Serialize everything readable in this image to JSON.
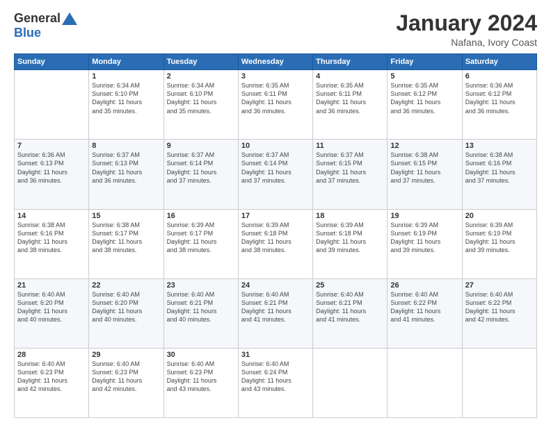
{
  "logo": {
    "general": "General",
    "blue": "Blue"
  },
  "header": {
    "month_year": "January 2024",
    "location": "Nafana, Ivory Coast"
  },
  "days_of_week": [
    "Sunday",
    "Monday",
    "Tuesday",
    "Wednesday",
    "Thursday",
    "Friday",
    "Saturday"
  ],
  "weeks": [
    [
      {
        "day": "",
        "info": ""
      },
      {
        "day": "1",
        "info": "Sunrise: 6:34 AM\nSunset: 6:10 PM\nDaylight: 11 hours\nand 35 minutes."
      },
      {
        "day": "2",
        "info": "Sunrise: 6:34 AM\nSunset: 6:10 PM\nDaylight: 11 hours\nand 35 minutes."
      },
      {
        "day": "3",
        "info": "Sunrise: 6:35 AM\nSunset: 6:11 PM\nDaylight: 11 hours\nand 36 minutes."
      },
      {
        "day": "4",
        "info": "Sunrise: 6:35 AM\nSunset: 6:11 PM\nDaylight: 11 hours\nand 36 minutes."
      },
      {
        "day": "5",
        "info": "Sunrise: 6:35 AM\nSunset: 6:12 PM\nDaylight: 11 hours\nand 36 minutes."
      },
      {
        "day": "6",
        "info": "Sunrise: 6:36 AM\nSunset: 6:12 PM\nDaylight: 11 hours\nand 36 minutes."
      }
    ],
    [
      {
        "day": "7",
        "info": "Sunrise: 6:36 AM\nSunset: 6:13 PM\nDaylight: 11 hours\nand 36 minutes."
      },
      {
        "day": "8",
        "info": "Sunrise: 6:37 AM\nSunset: 6:13 PM\nDaylight: 11 hours\nand 36 minutes."
      },
      {
        "day": "9",
        "info": "Sunrise: 6:37 AM\nSunset: 6:14 PM\nDaylight: 11 hours\nand 37 minutes."
      },
      {
        "day": "10",
        "info": "Sunrise: 6:37 AM\nSunset: 6:14 PM\nDaylight: 11 hours\nand 37 minutes."
      },
      {
        "day": "11",
        "info": "Sunrise: 6:37 AM\nSunset: 6:15 PM\nDaylight: 11 hours\nand 37 minutes."
      },
      {
        "day": "12",
        "info": "Sunrise: 6:38 AM\nSunset: 6:15 PM\nDaylight: 11 hours\nand 37 minutes."
      },
      {
        "day": "13",
        "info": "Sunrise: 6:38 AM\nSunset: 6:16 PM\nDaylight: 11 hours\nand 37 minutes."
      }
    ],
    [
      {
        "day": "14",
        "info": "Sunrise: 6:38 AM\nSunset: 6:16 PM\nDaylight: 11 hours\nand 38 minutes."
      },
      {
        "day": "15",
        "info": "Sunrise: 6:38 AM\nSunset: 6:17 PM\nDaylight: 11 hours\nand 38 minutes."
      },
      {
        "day": "16",
        "info": "Sunrise: 6:39 AM\nSunset: 6:17 PM\nDaylight: 11 hours\nand 38 minutes."
      },
      {
        "day": "17",
        "info": "Sunrise: 6:39 AM\nSunset: 6:18 PM\nDaylight: 11 hours\nand 38 minutes."
      },
      {
        "day": "18",
        "info": "Sunrise: 6:39 AM\nSunset: 6:18 PM\nDaylight: 11 hours\nand 39 minutes."
      },
      {
        "day": "19",
        "info": "Sunrise: 6:39 AM\nSunset: 6:19 PM\nDaylight: 11 hours\nand 39 minutes."
      },
      {
        "day": "20",
        "info": "Sunrise: 6:39 AM\nSunset: 6:19 PM\nDaylight: 11 hours\nand 39 minutes."
      }
    ],
    [
      {
        "day": "21",
        "info": "Sunrise: 6:40 AM\nSunset: 6:20 PM\nDaylight: 11 hours\nand 40 minutes."
      },
      {
        "day": "22",
        "info": "Sunrise: 6:40 AM\nSunset: 6:20 PM\nDaylight: 11 hours\nand 40 minutes."
      },
      {
        "day": "23",
        "info": "Sunrise: 6:40 AM\nSunset: 6:21 PM\nDaylight: 11 hours\nand 40 minutes."
      },
      {
        "day": "24",
        "info": "Sunrise: 6:40 AM\nSunset: 6:21 PM\nDaylight: 11 hours\nand 41 minutes."
      },
      {
        "day": "25",
        "info": "Sunrise: 6:40 AM\nSunset: 6:21 PM\nDaylight: 11 hours\nand 41 minutes."
      },
      {
        "day": "26",
        "info": "Sunrise: 6:40 AM\nSunset: 6:22 PM\nDaylight: 11 hours\nand 41 minutes."
      },
      {
        "day": "27",
        "info": "Sunrise: 6:40 AM\nSunset: 6:22 PM\nDaylight: 11 hours\nand 42 minutes."
      }
    ],
    [
      {
        "day": "28",
        "info": "Sunrise: 6:40 AM\nSunset: 6:23 PM\nDaylight: 11 hours\nand 42 minutes."
      },
      {
        "day": "29",
        "info": "Sunrise: 6:40 AM\nSunset: 6:23 PM\nDaylight: 11 hours\nand 42 minutes."
      },
      {
        "day": "30",
        "info": "Sunrise: 6:40 AM\nSunset: 6:23 PM\nDaylight: 11 hours\nand 43 minutes."
      },
      {
        "day": "31",
        "info": "Sunrise: 6:40 AM\nSunset: 6:24 PM\nDaylight: 11 hours\nand 43 minutes."
      },
      {
        "day": "",
        "info": ""
      },
      {
        "day": "",
        "info": ""
      },
      {
        "day": "",
        "info": ""
      }
    ]
  ]
}
